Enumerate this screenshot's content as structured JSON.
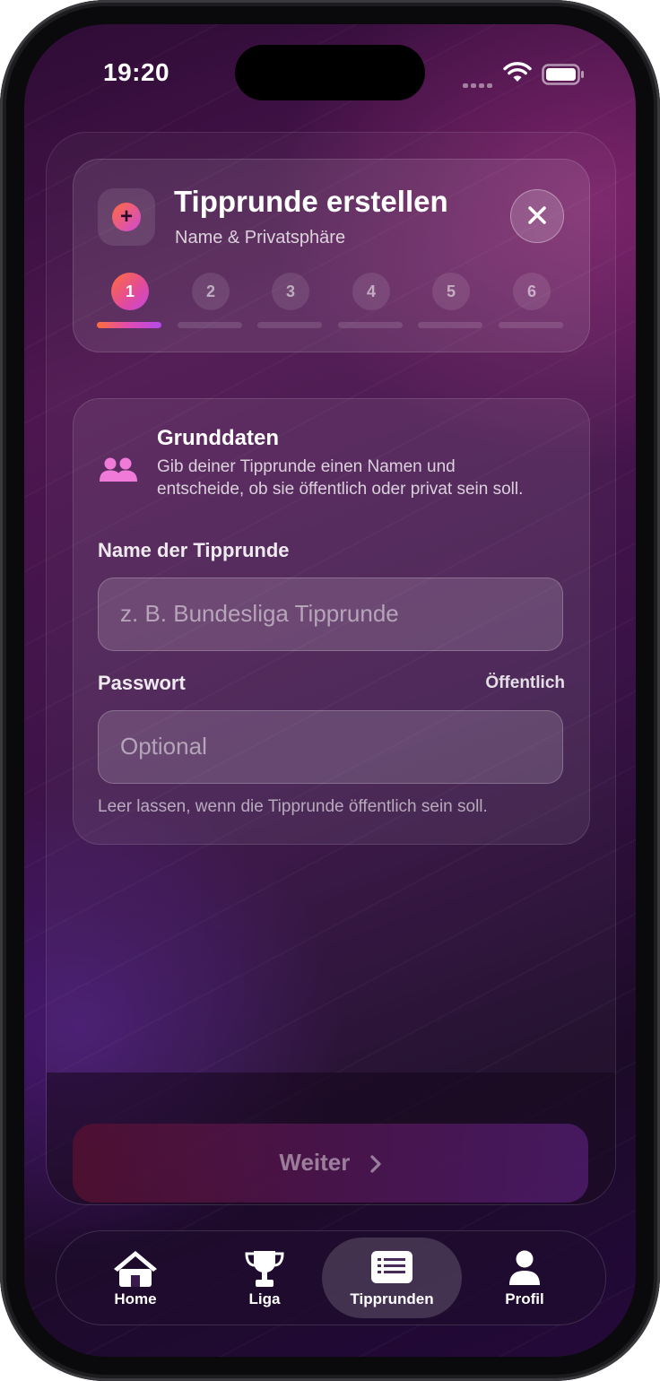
{
  "status_bar": {
    "time": "19:20"
  },
  "header": {
    "title": "Tipprunde erstellen",
    "subtitle": "Name & Privatsphäre",
    "steps": [
      "1",
      "2",
      "3",
      "4",
      "5",
      "6"
    ],
    "active_step": 1
  },
  "section": {
    "title": "Grunddaten",
    "description": "Gib deiner Tipprunde einen Namen und entscheide, ob sie öffentlich oder privat sein soll."
  },
  "fields": {
    "name": {
      "label": "Name der Tipprunde",
      "placeholder": "z. B. Bundesliga Tipprunde",
      "value": ""
    },
    "password": {
      "label": "Passwort",
      "badge": "Öffentlich",
      "placeholder": "Optional",
      "value": ""
    },
    "hint": "Leer lassen, wenn die Tipprunde öffentlich sein soll."
  },
  "actions": {
    "next_label": "Weiter"
  },
  "tabs": [
    {
      "label": "Home",
      "icon": "house-icon"
    },
    {
      "label": "Liga",
      "icon": "trophy-icon"
    },
    {
      "label": "Tipprunden",
      "icon": "list-icon",
      "active": true
    },
    {
      "label": "Profil",
      "icon": "person-icon"
    }
  ],
  "colors": {
    "accent_start": "#ff6d3a",
    "accent_end": "#c34ae0",
    "background": "#3a1247"
  }
}
